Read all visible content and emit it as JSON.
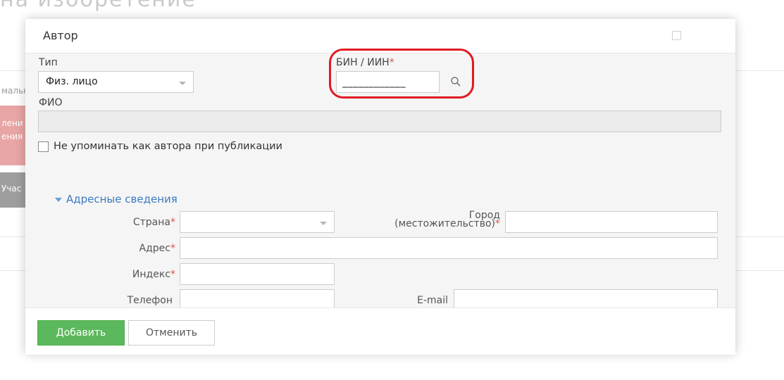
{
  "background": {
    "title": "на изобретение",
    "side_labels": [
      "мальн",
      "лени",
      "ения",
      "Учас"
    ]
  },
  "modal": {
    "title": "Автор",
    "type_label": "Тип",
    "type_value": "Физ. лицо",
    "bin_label": "БИН / ИИН",
    "required_mark": "*",
    "bin_value": "____________",
    "fio_label": "ФИО",
    "fio_value": "",
    "no_mention_label": "Не упоминать как автора при публикации",
    "address_section": "Адресные сведения",
    "country_label": "Страна",
    "city_label_line1": "Город",
    "city_label_line2": "(местожительство)",
    "address_label": "Адрес",
    "index_label": "Индекс",
    "phone_label": "Телефон",
    "email_label": "E-mail",
    "add_button": "Добавить",
    "cancel_button": "Отменить"
  },
  "icons": {
    "search": "search-icon",
    "close": "close-icon",
    "dropdown": "chevron-down-icon",
    "section_toggle": "triangle-down-icon"
  },
  "colors": {
    "primary": "#5cb85c",
    "required": "#d9534f",
    "link": "#3a7bbf",
    "highlight": "#e01b24"
  }
}
